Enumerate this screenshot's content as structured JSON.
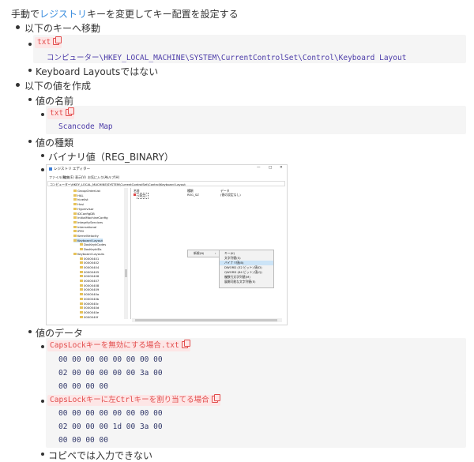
{
  "intro": {
    "prefix": "手動で",
    "link": "レジストリ",
    "suffix": "キーを変更してキー配置を設定する"
  },
  "step1": {
    "label": "以下のキーへ移動",
    "tag": "txt",
    "code": "コンピューター\\HKEY_LOCAL_MACHINE\\SYSTEM\\CurrentControlSet\\Control\\Keyboard Layout",
    "note": "Keyboard Layoutsではない"
  },
  "step2": {
    "label": "以下の値を作成",
    "name_label": "値の名前",
    "name_tag": "txt",
    "name_code": "Scancode Map",
    "type_label": "値の種類",
    "type_value": "バイナリ値（REG_BINARY）",
    "data_label": "値のデータ",
    "data1_tag": "CapsLockキーを無効にする場合.txt",
    "data1_lines": [
      "00 00 00 00 00 00 00 00",
      "02 00 00 00 00 00 3a 00",
      "00 00 00 00"
    ],
    "data2_tag": "CapsLockキーに左Ctrlキーを割り当てる場合",
    "data2_lines": [
      "00 00 00 00 00 00 00 00",
      "02 00 00 00 1d 00 3a 00",
      "00 00 00 00"
    ],
    "footnote": "コピペでは入力できない"
  },
  "regedit": {
    "title": "レジストリ エディター",
    "controls": [
      "—",
      "□",
      "✕"
    ],
    "menu": [
      "ファイル(F)",
      "編集(E)",
      "表示(V)",
      "お気に入り(A)",
      "ヘルプ(H)"
    ],
    "address": "コンピューター\\HKEY_LOCAL_MACHINE\\SYSTEM\\CurrentControlSet\\Control\\Keyboard Layout",
    "tree": [
      "GroupOrderList",
      "HAL",
      "hivelist",
      "Hvsi",
      "Hypervisor",
      "IDConfigDB",
      "InitialMachineConfig",
      "IntegrityServices",
      "International",
      "IPMI",
      "KernelVelocity",
      "Keyboard Layout",
      "DosKeybCodes",
      "DosKeybIDs",
      "Keyboard Layouts",
      "00000401",
      "00000402",
      "00000404",
      "00000405",
      "00000406",
      "00000407",
      "00000408",
      "00000409",
      "0000040a",
      "0000040b",
      "0000040c",
      "0000040d",
      "0000040e",
      "0000040f"
    ],
    "columns": [
      "名前",
      "種類",
      "データ"
    ],
    "row": [
      "(既定)",
      "REG_SZ",
      "(値の設定なし)"
    ],
    "ctx_main": "新規(N)",
    "ctx_sub": [
      "キー(K)",
      "文字列値(S)",
      "バイナリ値(B)",
      "DWORD (32 ビット) 値(D)",
      "QWORD (64 ビット) 値(Q)",
      "複数行文字列値(M)",
      "展開可能な文字列値(E)"
    ]
  }
}
